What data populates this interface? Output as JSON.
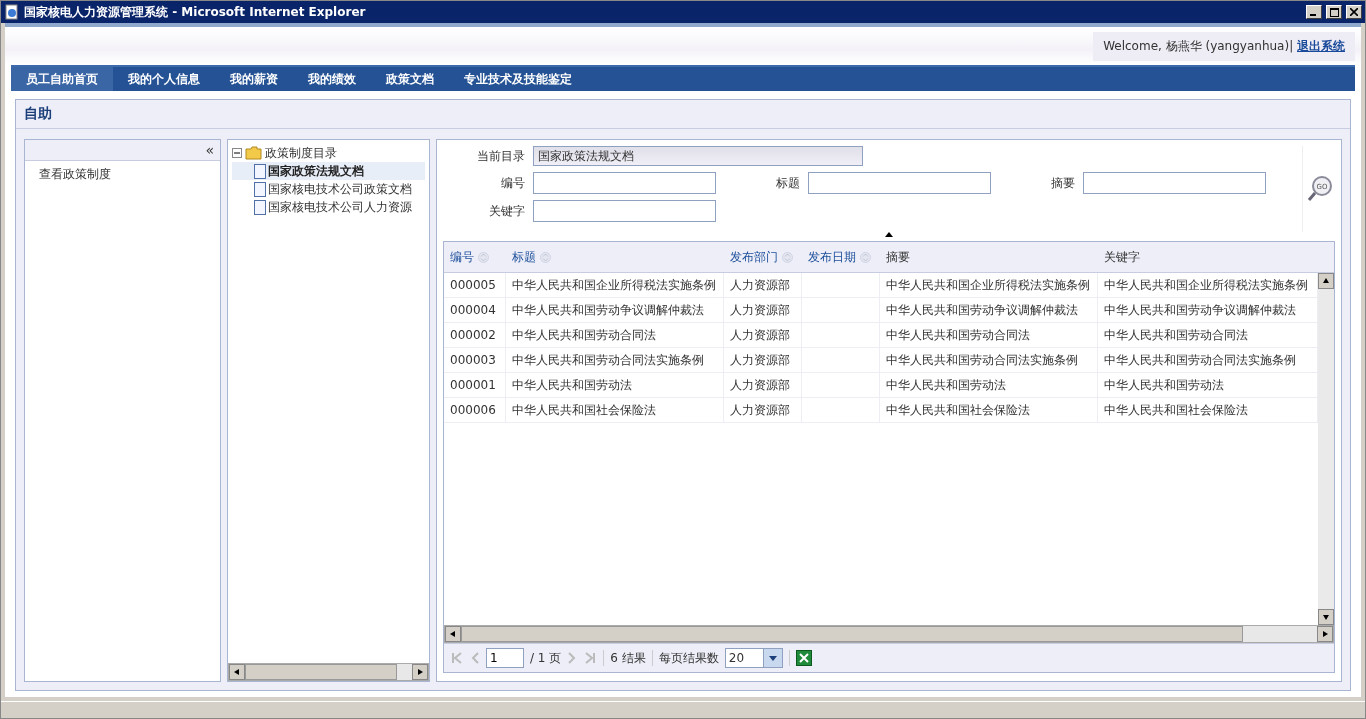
{
  "window": {
    "title": "国家核电人力资源管理系统 - Microsoft Internet Explorer"
  },
  "header": {
    "welcome": "Welcome, 杨燕华 (yangyanhua)|",
    "logout": "退出系统"
  },
  "nav": [
    {
      "label": "员工自助首页",
      "selected": true
    },
    {
      "label": "我的个人信息",
      "selected": false
    },
    {
      "label": "我的薪资",
      "selected": false
    },
    {
      "label": "我的绩效",
      "selected": false
    },
    {
      "label": "政策文档",
      "selected": false
    },
    {
      "label": "专业技术及技能鉴定",
      "selected": false
    }
  ],
  "panel": {
    "title": "自助"
  },
  "sidebar": {
    "collapse": "«",
    "items": [
      {
        "label": "查看政策制度"
      }
    ]
  },
  "tree": {
    "label": "政策制度目录",
    "expanded": true,
    "children": [
      {
        "label": "国家政策法规文档",
        "selected": true
      },
      {
        "label": "国家核电技术公司政策文档",
        "selected": false
      },
      {
        "label": "国家核电技术公司人力资源",
        "selected": false
      }
    ]
  },
  "search": {
    "go": "GO",
    "current_label": "当前目录",
    "current_value": "国家政策法规文档",
    "fields": [
      {
        "label": "编号"
      },
      {
        "label": "标题"
      },
      {
        "label": "摘要"
      },
      {
        "label": "关键字"
      }
    ]
  },
  "table": {
    "columns": [
      {
        "label": "编号",
        "sortable": true
      },
      {
        "label": "标题",
        "sortable": true
      },
      {
        "label": "发布部门",
        "sortable": true
      },
      {
        "label": "发布日期",
        "sortable": true
      },
      {
        "label": "摘要",
        "sortable": false
      },
      {
        "label": "关键字",
        "sortable": false
      }
    ],
    "rows": [
      [
        "000005",
        "中华人民共和国企业所得税法实施条例",
        "人力资源部",
        "",
        "中华人民共和国企业所得税法实施条例",
        "中华人民共和国企业所得税法实施条例"
      ],
      [
        "000004",
        "中华人民共和国劳动争议调解仲裁法",
        "人力资源部",
        "",
        "中华人民共和国劳动争议调解仲裁法",
        "中华人民共和国劳动争议调解仲裁法"
      ],
      [
        "000002",
        "中华人民共和国劳动合同法",
        "人力资源部",
        "",
        "中华人民共和国劳动合同法",
        "中华人民共和国劳动合同法"
      ],
      [
        "000003",
        "中华人民共和国劳动合同法实施条例",
        "人力资源部",
        "",
        "中华人民共和国劳动合同法实施条例",
        "中华人民共和国劳动合同法实施条例"
      ],
      [
        "000001",
        "中华人民共和国劳动法",
        "人力资源部",
        "",
        "中华人民共和国劳动法",
        "中华人民共和国劳动法"
      ],
      [
        "000006",
        "中华人民共和国社会保险法",
        "人力资源部",
        "",
        "中华人民共和国社会保险法",
        "中华人民共和国社会保险法"
      ]
    ]
  },
  "pager": {
    "page": "1",
    "page_total": "/ 1 页",
    "results": "6 结果",
    "per_page_label": "每页结果数",
    "per_page": "20"
  }
}
